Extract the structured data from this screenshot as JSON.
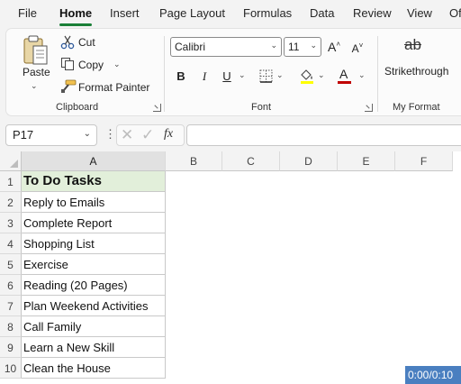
{
  "menu": {
    "tabs": [
      "File",
      "Home",
      "Insert",
      "Page Layout",
      "Formulas",
      "Data",
      "Review",
      "View",
      "Of"
    ]
  },
  "ribbon": {
    "clipboard": {
      "label": "Clipboard",
      "paste": "Paste",
      "cut": "Cut",
      "copy": "Copy",
      "format_painter": "Format Painter"
    },
    "font": {
      "label": "Font",
      "font_name": "Calibri",
      "font_size": "11",
      "bold": "B",
      "italic": "I",
      "underline": "U",
      "font_color_glyph": "A",
      "grow_glyph": "A",
      "shrink_glyph": "A"
    },
    "my_format": {
      "label": "My Format",
      "strikethrough": "Strikethrough",
      "strike_icon_text": "ab"
    }
  },
  "formula_bar": {
    "name_box": "P17",
    "fx": "fx",
    "formula": ""
  },
  "grid": {
    "columns": [
      "A",
      "B",
      "C",
      "D",
      "E",
      "F"
    ],
    "rows": [
      "1",
      "2",
      "3",
      "4",
      "5",
      "6",
      "7",
      "8",
      "9",
      "10"
    ],
    "cells_A": [
      "To Do Tasks",
      "Reply to Emails",
      "Complete Report",
      "Shopping List",
      "Exercise",
      "Reading (20 Pages)",
      "Plan Weekend Activities",
      "Call Family",
      "Learn a New Skill",
      "Clean the House"
    ]
  },
  "video_timer": "0:00/0:10",
  "colors": {
    "accent": "#1a7f37",
    "header_fill": "#e2efda",
    "font_color_bar": "#c00000"
  }
}
